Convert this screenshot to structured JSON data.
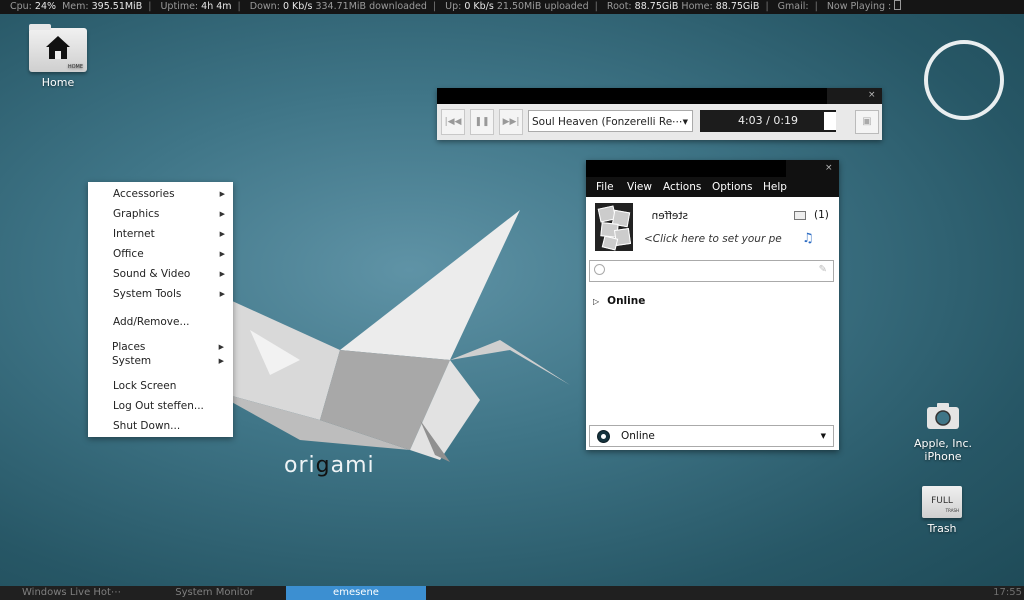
{
  "topbar": {
    "cpu_label": "Cpu:",
    "cpu": "24%",
    "mem_label": "Mem:",
    "mem": "395.51MiB",
    "uptime_label": "Uptime:",
    "uptime": "4h 4m",
    "down_label": "Down:",
    "down": "0 Kb/s",
    "down_total": "334.71MiB downloaded",
    "up_label": "Up:",
    "up": "0 Kb/s",
    "up_total": "21.50MiB uploaded",
    "root_label": "Root:",
    "root": "88.75GiB",
    "home_label": "Home:",
    "home": "88.75GiB",
    "gmail_label": "Gmail:",
    "nowplaying_label": "Now Playing :"
  },
  "desktop": {
    "home_label": "Home",
    "home_tag": "HOME",
    "iphone_label": "Apple, Inc. iPhone",
    "trash_label": "Trash",
    "trash_tag": "FULL",
    "trash_small": "TRASH",
    "brand_a": "ori",
    "brand_b": "g",
    "brand_c": "ami"
  },
  "app_menu": {
    "items": [
      {
        "label": "Accessories"
      },
      {
        "label": "Graphics"
      },
      {
        "label": "Internet"
      },
      {
        "label": "Office"
      },
      {
        "label": "Sound & Video"
      },
      {
        "label": "System Tools"
      },
      {
        "label": "Add/Remove..."
      },
      {
        "label": "Places"
      },
      {
        "label": "System"
      },
      {
        "label": "Lock Screen"
      },
      {
        "label": "Log Out steffen..."
      },
      {
        "label": "Shut Down..."
      }
    ]
  },
  "player": {
    "track": "Soul Heaven (Fonzerelli Re⋯",
    "time": "4:03 / 0:19"
  },
  "emesene": {
    "menu": {
      "file": "File",
      "view": "View",
      "actions": "Actions",
      "options": "Options",
      "help": "Help"
    },
    "nick": "steffen",
    "psm": "<Click here to set your per⋯",
    "mail_count": "(1)",
    "group": "Online",
    "status": "Online"
  },
  "taskbar": {
    "tasks": [
      {
        "label": "Windows Live Hot⋯"
      },
      {
        "label": "System Monitor"
      },
      {
        "label": "emesene"
      }
    ],
    "clock": "17:55"
  },
  "colors": {
    "taskbar_active": "#3c8fd1",
    "desktop": "#3f7587"
  }
}
